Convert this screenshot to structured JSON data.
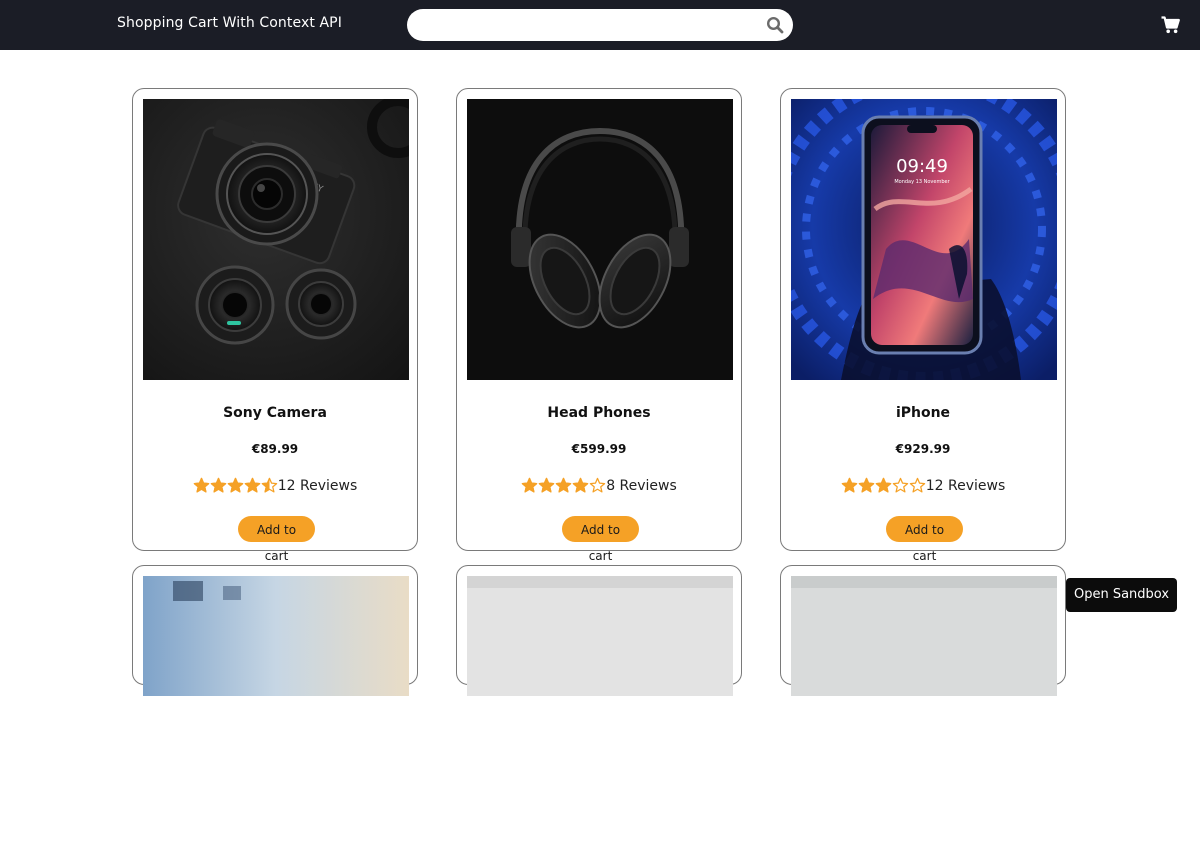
{
  "header": {
    "brand": "Shopping Cart With Context API",
    "search_placeholder": ""
  },
  "products": [
    {
      "name": "Sony Camera",
      "price": "€89.99",
      "rating": 4.5,
      "reviews": "12 Reviews",
      "button": "Add to cart",
      "image": "camera"
    },
    {
      "name": "Head Phones",
      "price": "€599.99",
      "rating": 4,
      "reviews": "8 Reviews",
      "button": "Add to cart",
      "image": "headphones"
    },
    {
      "name": "iPhone",
      "price": "€929.99",
      "rating": 3,
      "reviews": "12 Reviews",
      "button": "Add to cart",
      "image": "phone"
    }
  ],
  "phone_screen": {
    "time": "09:49",
    "date": "Monday 13 November"
  },
  "colors": {
    "navbar": "#1b1d26",
    "star": "#f5a126",
    "button": "#f5a126"
  },
  "sandbox_button": "Open Sandbox"
}
